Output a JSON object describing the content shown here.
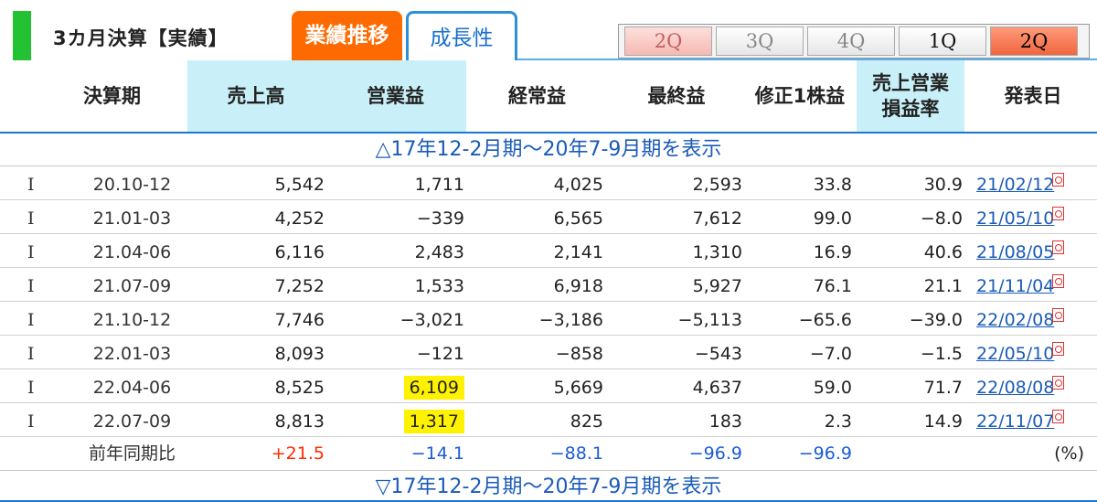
{
  "header": {
    "section_title": "3カ月決算【実績】",
    "tabs": [
      {
        "label": "業績推移",
        "active": true
      },
      {
        "label": "成長性",
        "active": false
      }
    ],
    "quarter_buttons": [
      "2Q",
      "3Q",
      "4Q",
      "1Q",
      "2Q"
    ],
    "active_quarter_index": 4
  },
  "columns": [
    "決算期",
    "売上高",
    "営業益",
    "経常益",
    "最終益",
    "修正1株益",
    "売上営業\n損益率",
    "発表日"
  ],
  "toggle_top": "△17年12-2月期～20年7-9月期を表示",
  "toggle_bottom": "▽17年12-2月期～20年7-9月期を表示",
  "rows": [
    {
      "type": "I",
      "period": "20.10-12",
      "sales": "5,542",
      "op": "1,711",
      "ordinary": "4,025",
      "net": "2,593",
      "eps": "33.8",
      "margin": "30.9",
      "date": "21/02/12"
    },
    {
      "type": "I",
      "period": "21.01-03",
      "sales": "4,252",
      "op": "−339",
      "ordinary": "6,565",
      "net": "7,612",
      "eps": "99.0",
      "margin": "−8.0",
      "date": "21/05/10"
    },
    {
      "type": "I",
      "period": "21.04-06",
      "sales": "6,116",
      "op": "2,483",
      "ordinary": "2,141",
      "net": "1,310",
      "eps": "16.9",
      "margin": "40.6",
      "date": "21/08/05"
    },
    {
      "type": "I",
      "period": "21.07-09",
      "sales": "7,252",
      "op": "1,533",
      "ordinary": "6,918",
      "net": "5,927",
      "eps": "76.1",
      "margin": "21.1",
      "date": "21/11/04"
    },
    {
      "type": "I",
      "period": "21.10-12",
      "sales": "7,746",
      "op": "−3,021",
      "ordinary": "−3,186",
      "net": "−5,113",
      "eps": "−65.6",
      "margin": "−39.0",
      "date": "22/02/08"
    },
    {
      "type": "I",
      "period": "22.01-03",
      "sales": "8,093",
      "op": "−121",
      "ordinary": "−858",
      "net": "−543",
      "eps": "−7.0",
      "margin": "−1.5",
      "date": "22/05/10"
    },
    {
      "type": "I",
      "period": "22.04-06",
      "sales": "8,525",
      "op": "6,109",
      "ordinary": "5,669",
      "net": "4,637",
      "eps": "59.0",
      "margin": "71.7",
      "date": "22/08/08"
    },
    {
      "type": "I",
      "period": "22.07-09",
      "sales": "8,813",
      "op": "1,317",
      "ordinary": "825",
      "net": "183",
      "eps": "2.3",
      "margin": "14.9",
      "date": "22/11/07"
    }
  ],
  "yoy": {
    "label": "前年同期比",
    "sales": "+21.5",
    "op": "−14.1",
    "ordinary": "−88.1",
    "net": "−96.9",
    "eps": "−96.9",
    "unit": "(%)"
  },
  "colors": {
    "tab_active": "#ff6a00",
    "tab_border": "#2f8fd8",
    "header_highlight": "#c9f0f8",
    "green_strip": "#22c232",
    "positive": "#ff2a00",
    "negative": "#1a5bd8",
    "value_highlight": "#fff200"
  }
}
